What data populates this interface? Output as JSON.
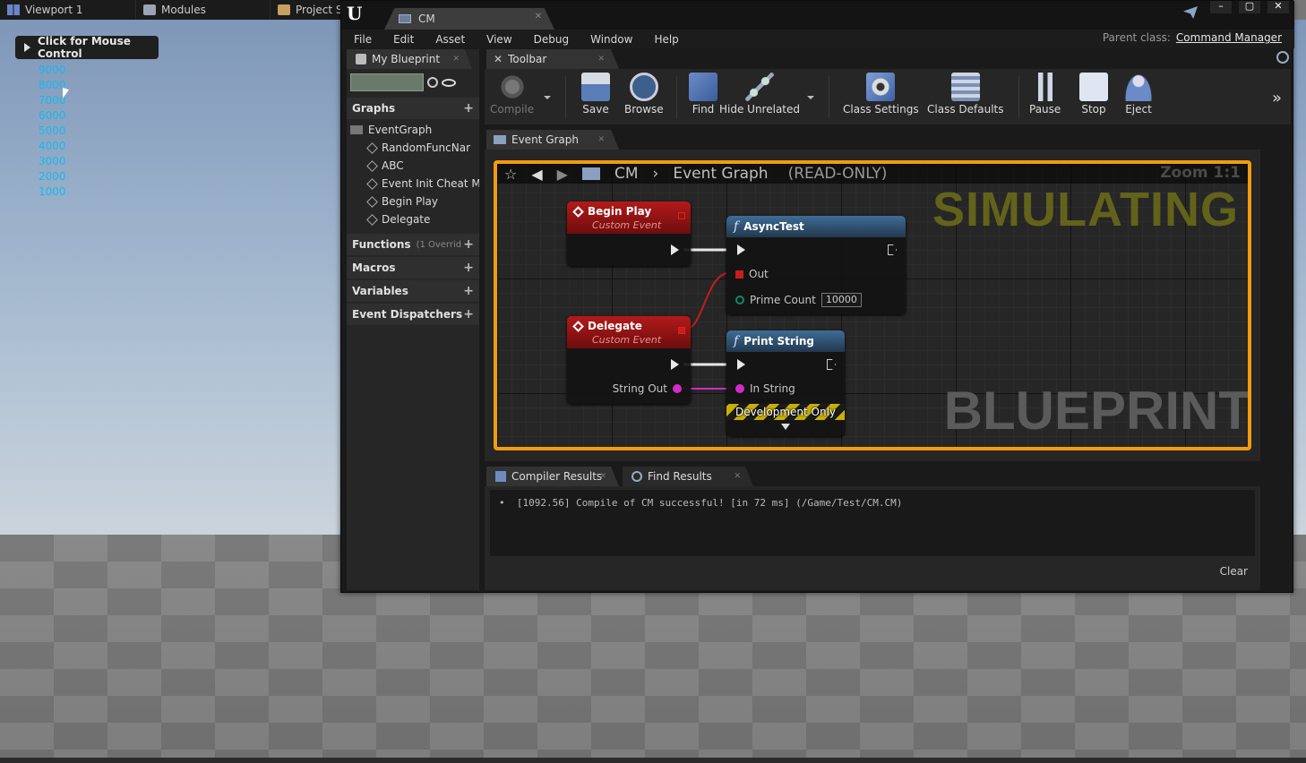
{
  "editor_tabs": [
    {
      "label": "Viewport 1",
      "icon": "viewport-icon"
    },
    {
      "label": "Modules",
      "icon": "modules-icon"
    },
    {
      "label": "Project S",
      "icon": "project-icon"
    }
  ],
  "viewport": {
    "mouse_control_label": "Click for Mouse Control",
    "numbers": [
      "9000",
      "8000",
      "7000",
      "6000",
      "5000",
      "4000",
      "3000",
      "2000",
      "1000"
    ],
    "number_color": "#18b8f0"
  },
  "window": {
    "doc_tab": "CM",
    "menu": [
      "File",
      "Edit",
      "Asset",
      "View",
      "Debug",
      "Window",
      "Help"
    ],
    "parent_class_label": "Parent class:",
    "parent_class_value": "Command Manager"
  },
  "my_blueprint": {
    "tab_label": "My Blueprint",
    "graphs_label": "Graphs",
    "event_graph": "EventGraph",
    "graph_items": [
      "RandomFuncNar",
      "ABC",
      "Event Init Cheat M",
      "Begin Play",
      "Delegate"
    ],
    "functions_label": "Functions",
    "functions_sub": "(1 Overrid",
    "macros_label": "Macros",
    "variables_label": "Variables",
    "dispatchers_label": "Event Dispatchers"
  },
  "toolbar": {
    "tab_label": "Toolbar",
    "compile": "Compile",
    "save": "Save",
    "browse": "Browse",
    "find": "Find",
    "hide_unrelated": "Hide Unrelated",
    "class_settings": "Class Settings",
    "class_defaults": "Class Defaults",
    "pause": "Pause",
    "stop": "Stop",
    "eject": "Eject"
  },
  "graph": {
    "tab_label": "Event Graph",
    "breadcrumb_bp": "CM",
    "breadcrumb_graph": "Event Graph",
    "readonly": "(READ-ONLY)",
    "zoom": "Zoom 1:1",
    "simulating": "SIMULATING",
    "watermark": "BLUEPRINT",
    "accent_color": "#f29b10",
    "nodes": {
      "begin_play": {
        "title": "Begin Play",
        "subtitle": "Custom Event"
      },
      "delegate": {
        "title": "Delegate",
        "subtitle": "Custom Event",
        "pin_out": "String Out"
      },
      "async_test": {
        "title": "AsyncTest",
        "pin_out": "Out",
        "pin_prime": "Prime Count",
        "prime_value": "10000"
      },
      "print_string": {
        "title": "Print String",
        "pin_in": "In String",
        "dev_only": "Development Only"
      }
    }
  },
  "compiler": {
    "tab_label": "Compiler Results",
    "find_tab_label": "Find Results",
    "log": "[1092.56] Compile of CM successful! [in 72 ms] (/Game/Test/CM.CM)",
    "clear": "Clear"
  }
}
